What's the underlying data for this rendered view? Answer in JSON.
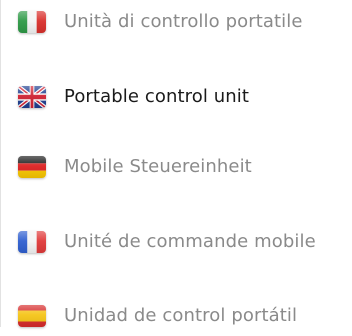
{
  "languages": [
    {
      "code": "it",
      "label": "Unità di controllo portatile",
      "flag": "italy-flag-icon",
      "active": false
    },
    {
      "code": "en",
      "label": "Portable control unit",
      "flag": "uk-flag-icon",
      "active": true
    },
    {
      "code": "de",
      "label": "Mobile Steuereinheit",
      "flag": "germany-flag-icon",
      "active": false
    },
    {
      "code": "fr",
      "label": "Unité de commande mobile",
      "flag": "france-flag-icon",
      "active": false
    },
    {
      "code": "es",
      "label": "Unidad de control portátil",
      "flag": "spain-flag-icon",
      "active": false
    }
  ],
  "colors": {
    "active_text": "#1a1a1a",
    "inactive_text": "#8a8a8a"
  }
}
